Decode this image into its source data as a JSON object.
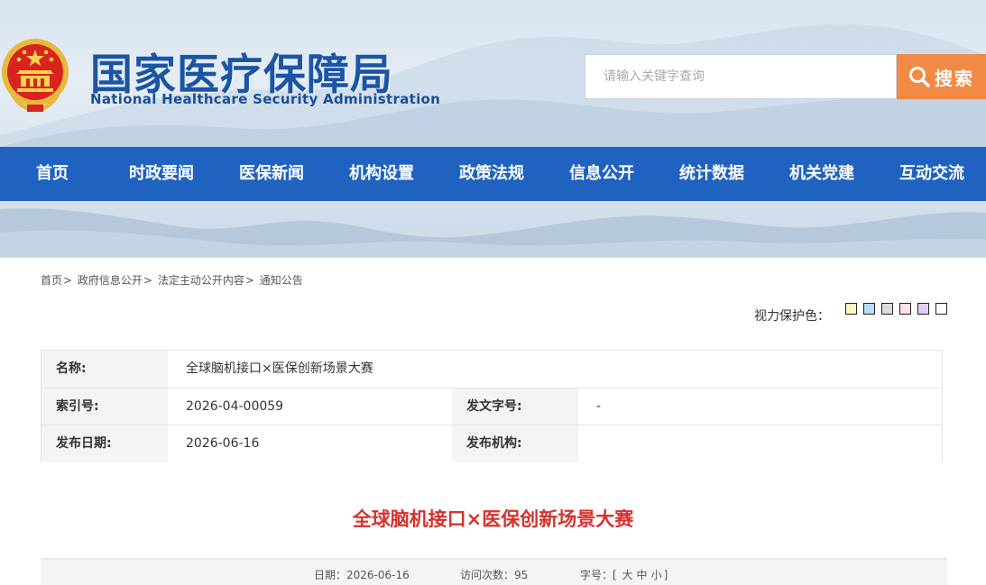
{
  "site": {
    "title": "国家医疗保障局",
    "subtitle": "National Healthcare Security Administration"
  },
  "search": {
    "placeholder": "请输入关键字查询",
    "button_label": "搜索"
  },
  "nav": {
    "items": [
      {
        "label": "首页"
      },
      {
        "label": "时政要闻"
      },
      {
        "label": "医保新闻"
      },
      {
        "label": "机构设置"
      },
      {
        "label": "政策法规"
      },
      {
        "label": "信息公开"
      },
      {
        "label": "统计数据"
      },
      {
        "label": "机关党建"
      },
      {
        "label": "互动交流"
      }
    ]
  },
  "breadcrumb": {
    "items": [
      "首页",
      "政府信息公开",
      "法定主动公开内容",
      "通知公告"
    ],
    "separator": ">"
  },
  "eye_protection": {
    "label": "视力保护色：",
    "colors": [
      "#fcf5c2",
      "#b9dbf3",
      "#dddddd",
      "#fbe0e6",
      "#e2cdf3",
      "#ffffff"
    ]
  },
  "info_table": {
    "name_label": "名称:",
    "name_value": "全球脑机接口×医保创新场景大赛",
    "index_label": "索引号:",
    "index_value": "2026-04-00059",
    "doc_no_label": "发文字号:",
    "doc_no_value": "-",
    "date_label": "发布日期:",
    "date_value": "2026-06-16",
    "org_label": "发布机构:",
    "org_value": ""
  },
  "article": {
    "title": "全球脑机接口×医保创新场景大赛",
    "date_label": "日期：",
    "date": "2026-06-16",
    "views_label": "访问次数：",
    "views": "95",
    "font_label": "字号：",
    "font_open": "[",
    "font_large": "大",
    "font_medium": "中",
    "font_small": "小",
    "font_close": "]"
  }
}
